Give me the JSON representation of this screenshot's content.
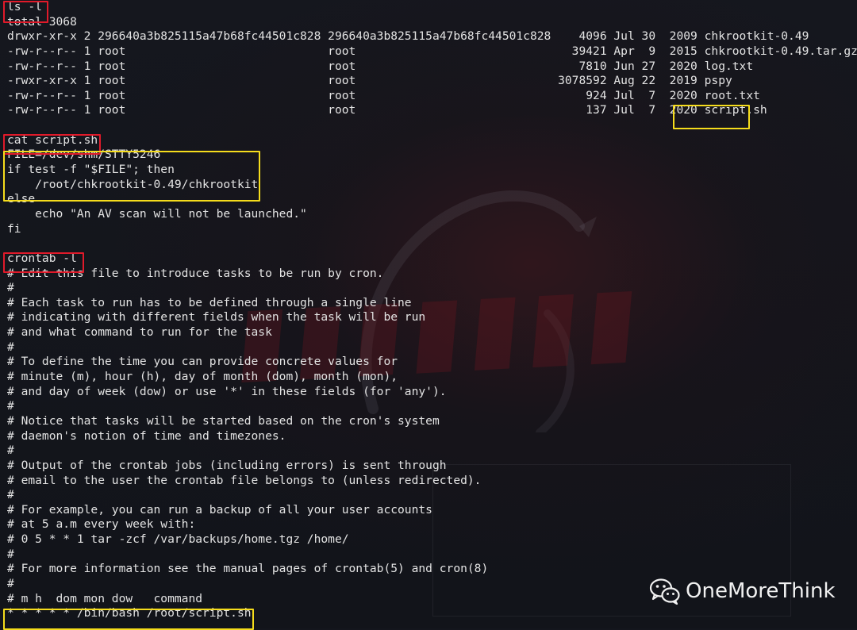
{
  "terminal": {
    "lines": [
      "ls -l",
      "total 3068",
      "drwxr-xr-x 2 296640a3b825115a47b68fc44501c828 296640a3b825115a47b68fc44501c828    4096 Jul 30  2009 chkrootkit-0.49",
      "-rw-r--r-- 1 root                             root                               39421 Apr  9  2015 chkrootkit-0.49.tar.gz",
      "-rw-r--r-- 1 root                             root                                7810 Jun 27  2020 log.txt",
      "-rwxr-xr-x 1 root                             root                             3078592 Aug 22  2019 pspy",
      "-rw-r--r-- 1 root                             root                                 924 Jul  7  2020 root.txt",
      "-rw-r--r-- 1 root                             root                                 137 Jul  7  2020 script.sh",
      "",
      "cat script.sh",
      "FILE=/dev/shm/STTY5246",
      "if test -f \"$FILE\"; then",
      "    /root/chkrootkit-0.49/chkrootkit",
      "else",
      "    echo \"An AV scan will not be launched.\"",
      "fi",
      "",
      "crontab -l",
      "# Edit this file to introduce tasks to be run by cron.",
      "#",
      "# Each task to run has to be defined through a single line",
      "# indicating with different fields when the task will be run",
      "# and what command to run for the task",
      "#",
      "# To define the time you can provide concrete values for",
      "# minute (m), hour (h), day of month (dom), month (mon),",
      "# and day of week (dow) or use '*' in these fields (for 'any').",
      "#",
      "# Notice that tasks will be started based on the cron's system",
      "# daemon's notion of time and timezones.",
      "#",
      "# Output of the crontab jobs (including errors) is sent through",
      "# email to the user the crontab file belongs to (unless redirected).",
      "#",
      "# For example, you can run a backup of all your user accounts",
      "# at 5 a.m every week with:",
      "# 0 5 * * 1 tar -zcf /var/backups/home.tgz /home/",
      "#",
      "# For more information see the manual pages of crontab(5) and cron(8)",
      "#",
      "# m h  dom mon dow   command",
      "* * * * * /bin/bash /root/script.sh"
    ]
  },
  "watermark": {
    "account_name": "OneMoreThink",
    "icon": "wechat-icon"
  },
  "colors": {
    "background": "#14161d",
    "text": "#e3e3e3",
    "highlight_red": "#e01a2a",
    "highlight_yellow": "#f5dc1c"
  }
}
